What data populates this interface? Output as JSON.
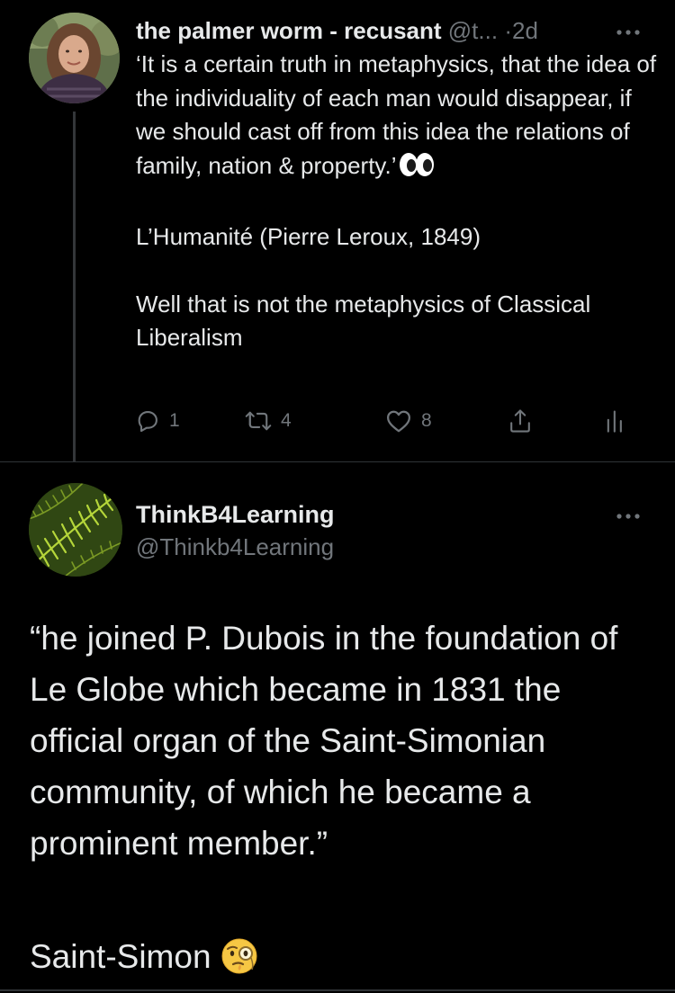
{
  "thread_tweet": {
    "author_name": "the palmer worm - recusant",
    "author_handle": "@t...",
    "separator": "·",
    "timestamp": "2d",
    "more_icon": "ellipsis-icon",
    "avatar_icon": "profile-photo",
    "body_paragraphs": [
      "‘It is a certain truth in metaphysics, that the idea of the individuality of each man would disappear, if we should cast off from this idea the relations of family, nation & property.’",
      "L’Humanité (Pierre Leroux, 1849)",
      "Well that is not the metaphysics of Classical Liberalism"
    ],
    "body_emoji": "eyes-emoji",
    "actions": {
      "reply_count": "1",
      "retweet_count": "4",
      "like_count": "8"
    }
  },
  "focused_tweet": {
    "author_name": "ThinkB4Learning",
    "author_handle": "@Thinkb4Learning",
    "more_icon": "ellipsis-icon",
    "avatar_icon": "fern-photo",
    "body": "“he joined P. Dubois in the foundation of Le Globe which became in 1831 the official organ of the Saint-Simonian community, of which he became a prominent member.”",
    "signature": "Saint-Simon",
    "signature_emoji": "face-with-monocle-emoji"
  },
  "colors": {
    "background": "#000000",
    "text_primary": "#e7e9ea",
    "text_secondary": "#71767b",
    "divider": "#2f3336"
  }
}
